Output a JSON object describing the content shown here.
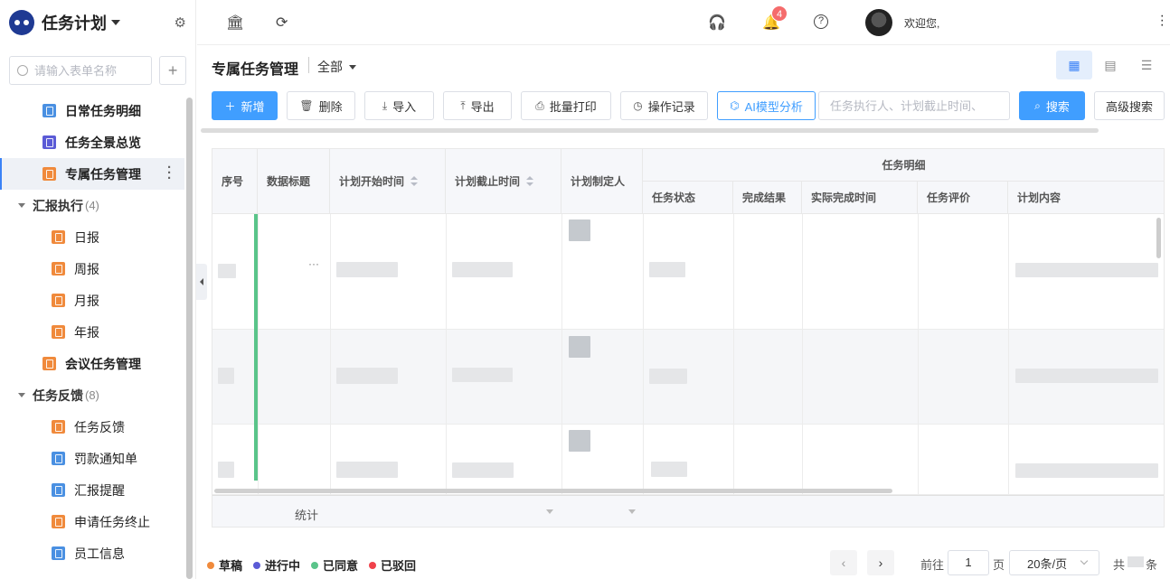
{
  "sidebar": {
    "app_title": "任务计划",
    "search_placeholder": "请输入表单名称",
    "items": [
      {
        "label": "日常任务明细"
      },
      {
        "label": "任务全景总览"
      },
      {
        "label": "专属任务管理"
      },
      {
        "label": "汇报执行",
        "count": "(4)"
      },
      {
        "label": "日报"
      },
      {
        "label": "周报"
      },
      {
        "label": "月报"
      },
      {
        "label": "年报"
      },
      {
        "label": "会议任务管理"
      },
      {
        "label": "任务反馈",
        "count": "(8)"
      },
      {
        "label": "任务反馈"
      },
      {
        "label": "罚款通知单"
      },
      {
        "label": "汇报提醒"
      },
      {
        "label": "申请任务终止"
      },
      {
        "label": "员工信息"
      }
    ]
  },
  "topbar": {
    "notification_count": "4",
    "welcome": "欢迎您,"
  },
  "page": {
    "title": "专属任务管理",
    "scope": "全部"
  },
  "toolbar": {
    "add": "新增",
    "delete": "删除",
    "import": "导入",
    "export": "导出",
    "batch_print": "批量打印",
    "history": "操作记录",
    "ai": "AI模型分析",
    "search_placeholder": "任务执行人、计划截止时间、",
    "search": "搜索",
    "advanced": "高级搜索"
  },
  "table": {
    "columns": {
      "index": "序号",
      "data_title": "数据标题",
      "plan_start": "计划开始时间",
      "plan_end": "计划截止时间",
      "planner": "计划制定人",
      "group": "任务明细",
      "status": "任务状态",
      "result": "完成结果",
      "actual_done": "实际完成时间",
      "evaluation": "任务评价",
      "content": "计划内容"
    },
    "ellipsis": "···",
    "summary_label": "统计"
  },
  "legend": [
    {
      "label": "草稿",
      "color": "#f08a3c"
    },
    {
      "label": "进行中",
      "color": "#5b5bd6"
    },
    {
      "label": "已同意",
      "color": "#5ac48a"
    },
    {
      "label": "已驳回",
      "color": "#f0424b"
    }
  ],
  "pagination": {
    "goto": "前往",
    "page": "1",
    "page_unit": "页",
    "page_size": "20条/页",
    "total_prefix": "共",
    "total_suffix": "条"
  },
  "icons": {
    "logo": "robot-logo-icon",
    "gear": "gear-icon",
    "home": "bank-icon",
    "refresh": "refresh-icon",
    "support": "headset-icon",
    "bell": "bell-icon",
    "help": "question-icon"
  },
  "colors": {
    "primary": "#409eff",
    "approved": "#5ac48a"
  }
}
